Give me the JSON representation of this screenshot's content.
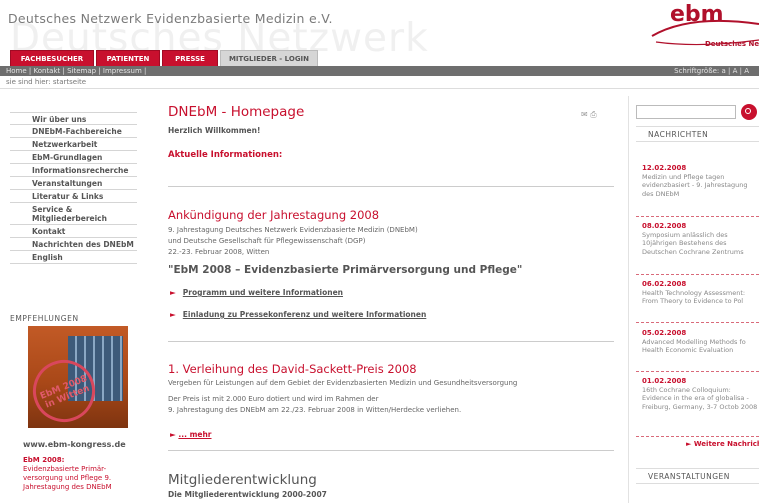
{
  "header": {
    "site_title": "Deutsches Netzwerk Evidenzbasierte Medizin e.V.",
    "watermark": "Deutsches Netzwerk",
    "logo_text": "ebm",
    "logo_sub": "Deutsches Netz"
  },
  "tabs": [
    "FACHBESUCHER",
    "PATIENTEN",
    "PRESSE",
    "MITGLIEDER - LOGIN"
  ],
  "topbar": {
    "links": "Home | Kontakt | Sitemap | Impressum |",
    "fontsize": "Schriftgröße: a | A | A"
  },
  "breadcrumb": "sie sind hier: startseite",
  "sidebar": {
    "items": [
      "Wir über uns",
      "DNEbM-Fachbereiche",
      "Netzwerkarbeit",
      "EbM-Grundlagen",
      "Informationsrecherche",
      "Veranstaltungen",
      "Literatur & Links",
      "Service & Mitgliederbereich",
      "Kontakt",
      "Nachrichten des DNEbM",
      "English"
    ]
  },
  "empfehlungen": {
    "title": "EMPFEHLUNGEN",
    "stamp_text": "EbM 2008 in Witten",
    "url": "www.ebm-kongress.de",
    "date": "EbM 2008:",
    "desc": "Evidenzbasierte Primär-versorgung und Pflege 9. Jahrestagung des DNEbM"
  },
  "main": {
    "title": "DNEbM - Homepage",
    "welcome": "Herzlich Willkommen!",
    "aktuell": "Aktuelle Informationen:",
    "section1": {
      "title": "Ankündigung der Jahrestagung 2008",
      "line1": "9. Jahrestagung Deutsches Netzwerk Evidenzbasierte Medizin (DNEbM)",
      "line2": "und Deutsche Gesellschaft für Pflegewissenschaft (DGP)",
      "line3": "22.-23. Februar 2008, Witten",
      "quote": "\"EbM 2008 – Evidenzbasierte Primärversorgung und Pflege\"",
      "link1": "Programm und weitere Informationen",
      "link2": "Einladung zu Pressekonferenz und weitere Informationen"
    },
    "section2": {
      "title": "1. Verleihung des David-Sackett-Preis 2008",
      "line1": "Vergeben für Leistungen auf dem Gebiet der Evidenzbasierten Medizin und Gesundheitsversorgung",
      "line2": "Der Preis ist mit 2.000 Euro dotiert und wird im Rahmen der",
      "line3": "9. Jahrestagung des DNEbM am 22./23. Februar 2008 in Witten/Herdecke verliehen.",
      "mehr": "... mehr"
    },
    "section3": {
      "title": "Mitgliederentwicklung",
      "subtitle": "Die Mitgliederentwicklung 2000-2007"
    }
  },
  "right": {
    "nachrichten_head": "NACHRICHTEN",
    "news": [
      {
        "date": "12.02.2008",
        "text": "Medizin und Pflege tagen evidenzbasiert - 9. Jahrestagung des DNEbM"
      },
      {
        "date": "08.02.2008",
        "text": "Symposium anlässlich des 10jährigen Bestehens des Deutschen Cochrane Zentrums"
      },
      {
        "date": "06.02.2008",
        "text": "Health Technology Assessment: From Theory to Evidence to Pol"
      },
      {
        "date": "05.02.2008",
        "text": "Advanced Modelling Methods fo Health Economic Evaluation"
      },
      {
        "date": "01.02.2008",
        "text": "16th Cochrane Colloquium: Evidence in the era of globalisa - Freiburg, Germany, 3-7 Octob 2008"
      }
    ],
    "weitere": "Weitere Nachrich",
    "veranstaltungen_head": "VERANSTALTUNGEN"
  },
  "colors": {
    "accent": "#c8102e",
    "topbar": "#6e6e6e"
  }
}
